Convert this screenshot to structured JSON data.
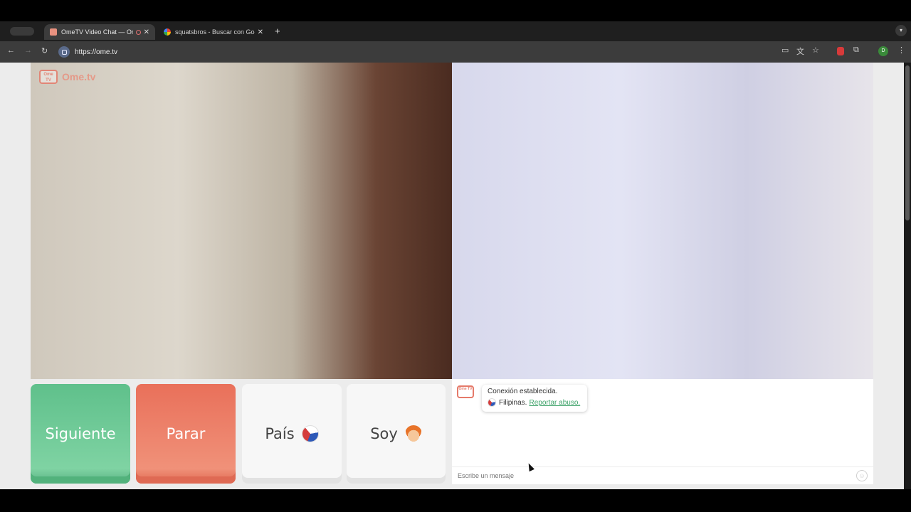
{
  "browser": {
    "tabs": [
      {
        "title": "OmeTV Video Chat — Ome",
        "active": true
      },
      {
        "title": "squatsbros - Buscar con Goo",
        "active": false
      }
    ],
    "new_tab": "+",
    "url": "https://ome.tv",
    "profile_initial": "D"
  },
  "site": {
    "logo_text": "Ome.tv",
    "logo_badge": "Ome TV"
  },
  "controls": {
    "next_label": "Siguiente",
    "stop_label": "Parar",
    "country_label": "País",
    "country_icon": "philippines-flag-icon",
    "gender_label": "Soy",
    "gender_icon": "boy-avatar-icon"
  },
  "chat": {
    "status": "Conexión establecida.",
    "country": "Filipinas.",
    "report_link": "Reportar abuso.",
    "input_placeholder": "Escribe un mensaje",
    "emoji_icon": "smiley-icon"
  },
  "colors": {
    "next_button": "#5fc08b",
    "stop_button": "#e9705a",
    "report_link": "#3fa36a",
    "logo": "#e8917f"
  }
}
